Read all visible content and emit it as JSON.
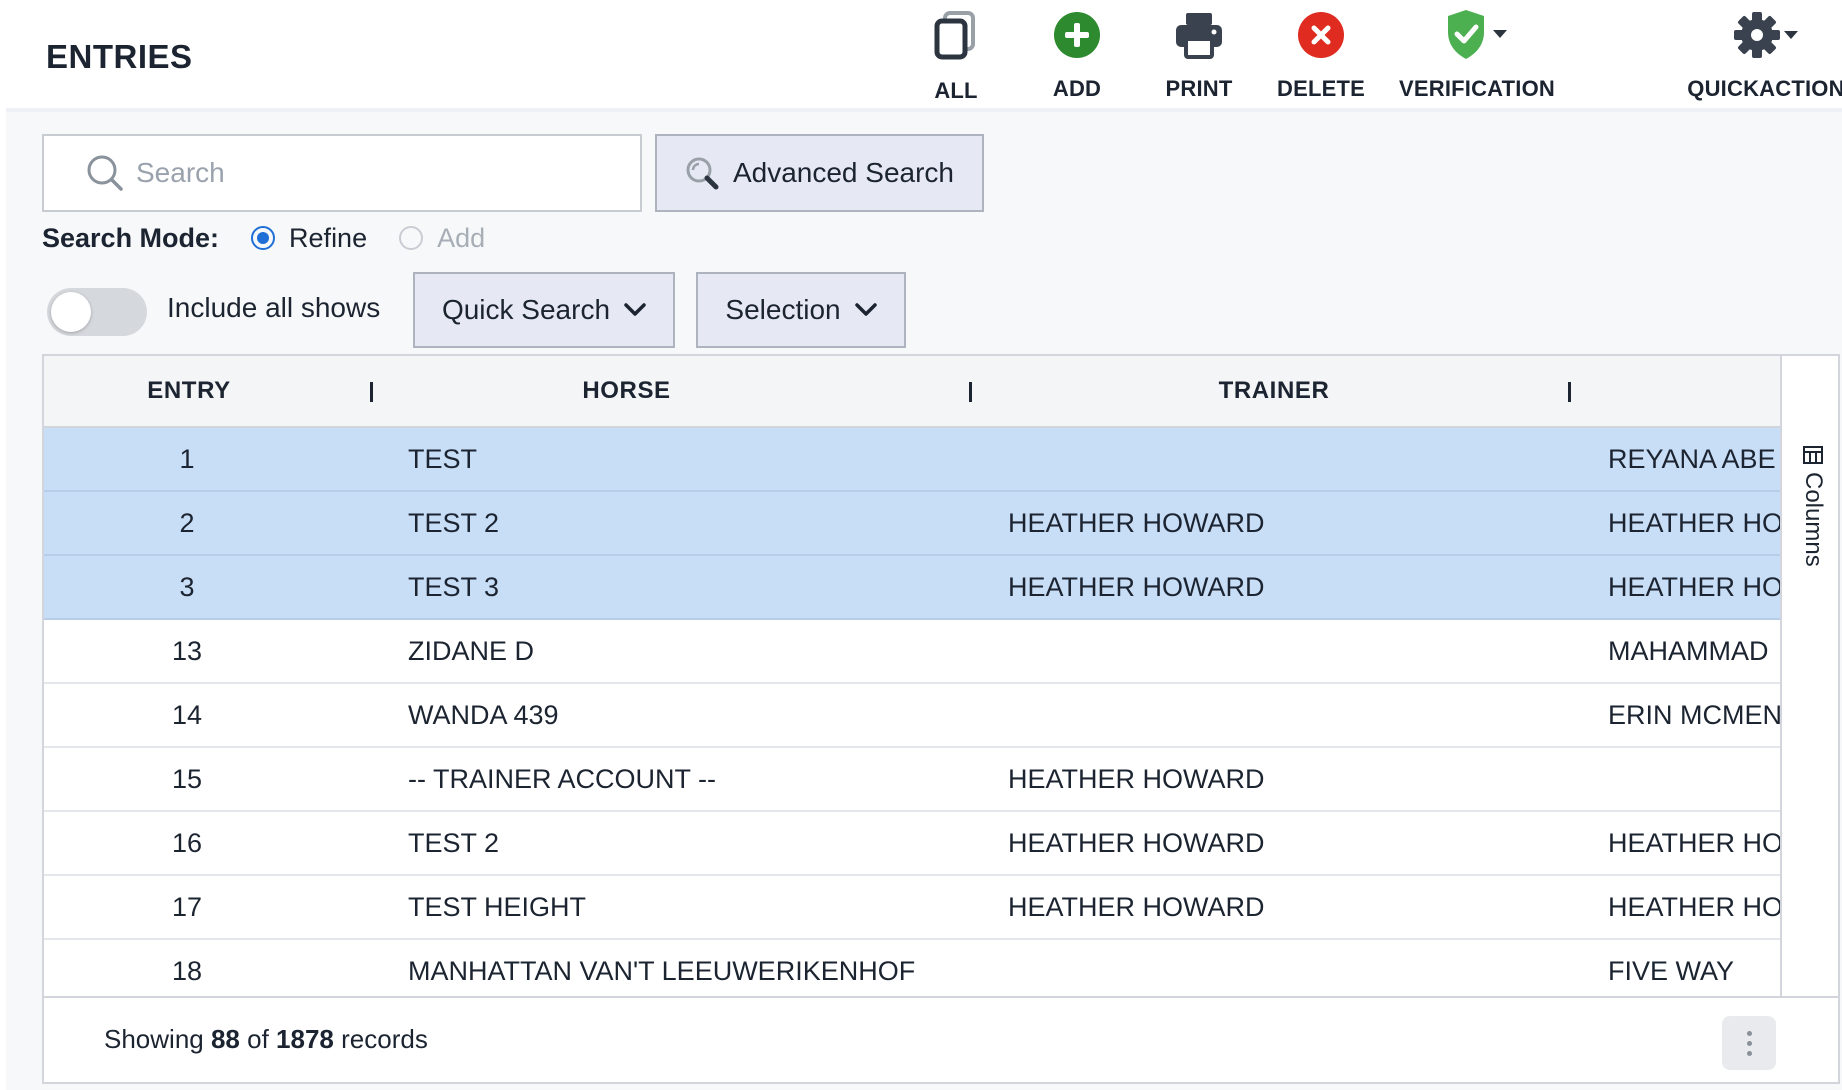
{
  "header": {
    "title": "ENTRIES",
    "toolbar": [
      {
        "id": "all",
        "label": "ALL",
        "icon": "copy-icon"
      },
      {
        "id": "add",
        "label": "ADD",
        "icon": "plus-circle-icon",
        "color": "#2e8a2e"
      },
      {
        "id": "print",
        "label": "PRINT",
        "icon": "printer-icon"
      },
      {
        "id": "delete",
        "label": "DELETE",
        "icon": "x-circle-icon",
        "color": "#e02c20"
      },
      {
        "id": "verification",
        "label": "VERIFICATION",
        "icon": "shield-check-icon",
        "color": "#4caf50"
      },
      {
        "id": "quickaction",
        "label": "QUICKACTION",
        "icon": "gear-icon"
      }
    ]
  },
  "search": {
    "placeholder": "Search",
    "value": "",
    "advanced_label": "Advanced Search"
  },
  "search_mode": {
    "label": "Search Mode:",
    "options": [
      {
        "label": "Refine",
        "selected": true,
        "disabled": false
      },
      {
        "label": "Add",
        "selected": false,
        "disabled": true
      }
    ]
  },
  "filters": {
    "include_all_shows_label": "Include all shows",
    "include_all_shows": false,
    "quick_search_label": "Quick Search",
    "selection_label": "Selection"
  },
  "grid": {
    "columns": [
      "ENTRY",
      "HORSE",
      "TRAINER"
    ],
    "rows": [
      {
        "entry": "1",
        "horse": "TEST",
        "trainer": "",
        "owner": "REYANA ABE",
        "selected": true
      },
      {
        "entry": "2",
        "horse": "TEST 2",
        "trainer": "HEATHER HOWARD",
        "owner": "HEATHER HO",
        "selected": true
      },
      {
        "entry": "3",
        "horse": "TEST 3",
        "trainer": "HEATHER HOWARD",
        "owner": "HEATHER HO",
        "selected": true
      },
      {
        "entry": "13",
        "horse": "ZIDANE D",
        "trainer": "",
        "owner": "MAHAMMAD",
        "selected": false
      },
      {
        "entry": "14",
        "horse": "WANDA 439",
        "trainer": "",
        "owner": "ERIN MCMEN",
        "selected": false
      },
      {
        "entry": "15",
        "horse": "-- TRAINER ACCOUNT --",
        "trainer": "HEATHER HOWARD",
        "owner": "",
        "selected": false
      },
      {
        "entry": "16",
        "horse": "TEST 2",
        "trainer": "HEATHER HOWARD",
        "owner": "HEATHER HO",
        "selected": false
      },
      {
        "entry": "17",
        "horse": "TEST HEIGHT",
        "trainer": "HEATHER HOWARD",
        "owner": "HEATHER HO",
        "selected": false
      },
      {
        "entry": "18",
        "horse": "MANHATTAN VAN'T LEEUWERIKENHOF",
        "trainer": "",
        "owner": "FIVE WAY",
        "selected": false
      }
    ],
    "columns_panel_label": "Columns",
    "footer": {
      "prefix": "Showing",
      "shown": "88",
      "of": "of",
      "total": "1878",
      "suffix": "records"
    }
  },
  "colors": {
    "selected_row": "#c8ddf6",
    "accent": "#1f6fd6",
    "button_bg": "#e6e9f3"
  }
}
